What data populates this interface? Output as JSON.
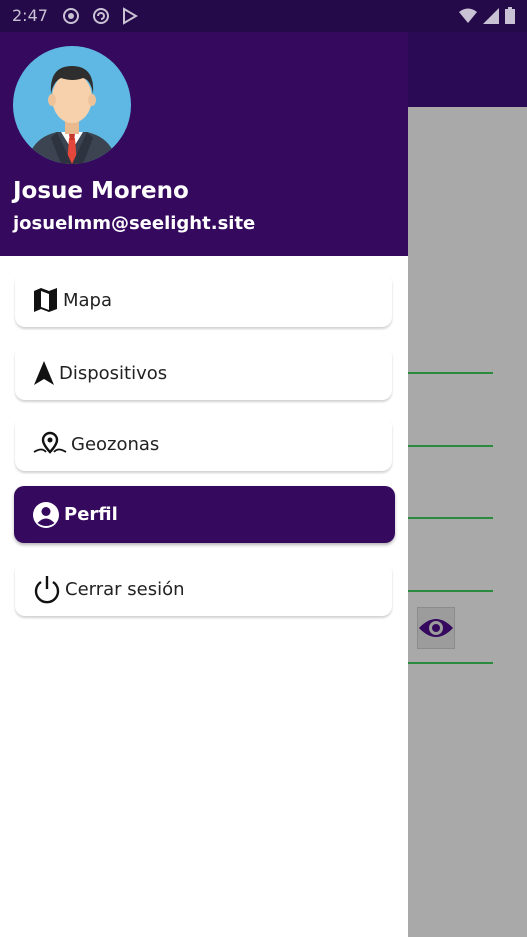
{
  "status_bar": {
    "time": "2:47"
  },
  "user": {
    "name": "Josue Moreno",
    "email": "josuelmm@seelight.site"
  },
  "menu": {
    "items": [
      {
        "label": "Mapa",
        "icon": "map-icon"
      },
      {
        "label": "Dispositivos",
        "icon": "navigation-arrow-icon"
      },
      {
        "label": "Geozonas",
        "icon": "location-pin-icon"
      },
      {
        "label": "Perfil",
        "icon": "account-circle-icon",
        "active": true
      },
      {
        "label": "Cerrar sesión",
        "icon": "power-icon"
      }
    ]
  },
  "colors": {
    "primary": "#35095e",
    "status_bar": "#250a4a",
    "accent_line": "#2a8a3e",
    "scrim": "#a9a9a9"
  }
}
